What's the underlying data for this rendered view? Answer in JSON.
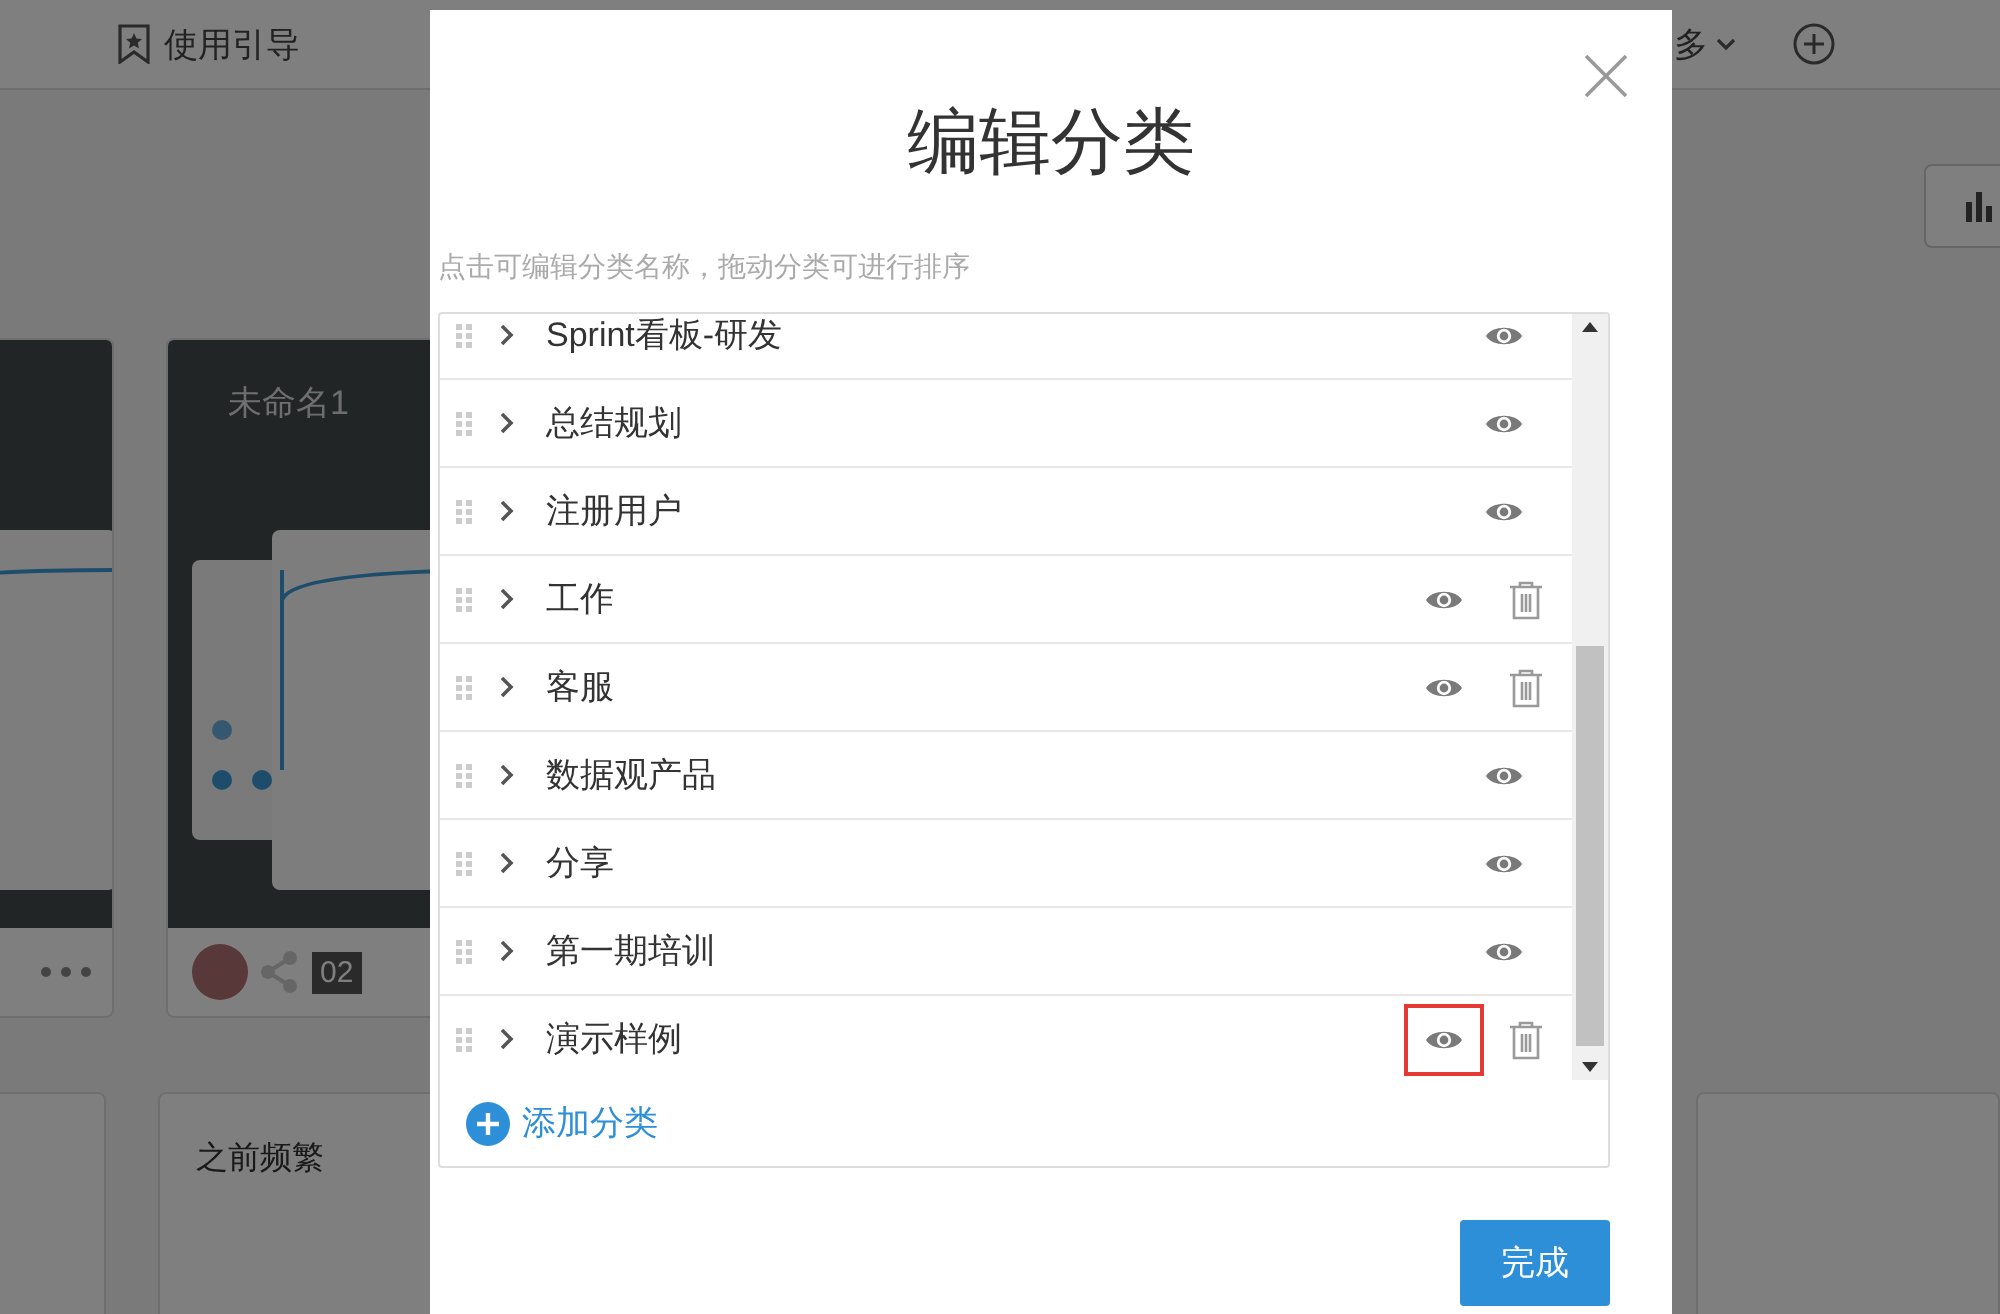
{
  "background": {
    "nav_link": "使用引导",
    "nav_more": "多",
    "card_title": "未命名1",
    "card_date": "02",
    "note": "之前频繁"
  },
  "dialog": {
    "title": "编辑分类",
    "hint": "点击可编辑分类名称，拖动分类可进行排序",
    "categories": [
      {
        "name": "Sprint看板-研发",
        "deletable": false,
        "highlighted": false
      },
      {
        "name": "总结规划",
        "deletable": false,
        "highlighted": false
      },
      {
        "name": "注册用户",
        "deletable": false,
        "highlighted": false
      },
      {
        "name": "工作",
        "deletable": true,
        "highlighted": false
      },
      {
        "name": "客服",
        "deletable": true,
        "highlighted": false
      },
      {
        "name": "数据观产品",
        "deletable": false,
        "highlighted": false
      },
      {
        "name": "分享",
        "deletable": false,
        "highlighted": false
      },
      {
        "name": "第一期培训",
        "deletable": false,
        "highlighted": false
      },
      {
        "name": "演示样例",
        "deletable": true,
        "highlighted": true
      }
    ],
    "add_label": "添加分类",
    "done_button": "完成"
  }
}
